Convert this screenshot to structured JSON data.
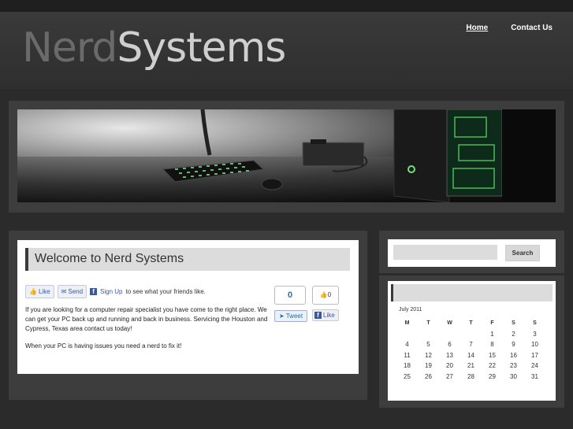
{
  "logo": {
    "part1": "Nerd",
    "part2": "Systems"
  },
  "nav": [
    {
      "label": "Home"
    },
    {
      "label": "Contact Us"
    }
  ],
  "main": {
    "title": "Welcome to Nerd Systems",
    "fb": {
      "like": "Like",
      "send": "Send",
      "signup": "Sign Up",
      "signup_rest": "to see what your friends like."
    },
    "para1": "If you are looking for a computer repair specialist you have come to the right place. We can get your PC back up and running and back in business. Servicing the Houston and Cypress, Texas area contact us today!",
    "para2": "When your PC is having issues you need a nerd to fix it!",
    "tweet_count": "0",
    "tweet_label": "Tweet",
    "like_count": "0",
    "like_label": "Like"
  },
  "search": {
    "button": "Search"
  },
  "calendar": {
    "caption": "July 2011",
    "days": [
      "M",
      "T",
      "W",
      "T",
      "F",
      "S",
      "S"
    ],
    "weeks": [
      [
        "",
        "",
        "",
        "",
        "1",
        "2",
        "3"
      ],
      [
        "4",
        "5",
        "6",
        "7",
        "8",
        "9",
        "10"
      ],
      [
        "11",
        "12",
        "13",
        "14",
        "15",
        "16",
        "17"
      ],
      [
        "18",
        "19",
        "20",
        "21",
        "22",
        "23",
        "24"
      ],
      [
        "25",
        "26",
        "27",
        "28",
        "29",
        "30",
        "31"
      ]
    ]
  }
}
